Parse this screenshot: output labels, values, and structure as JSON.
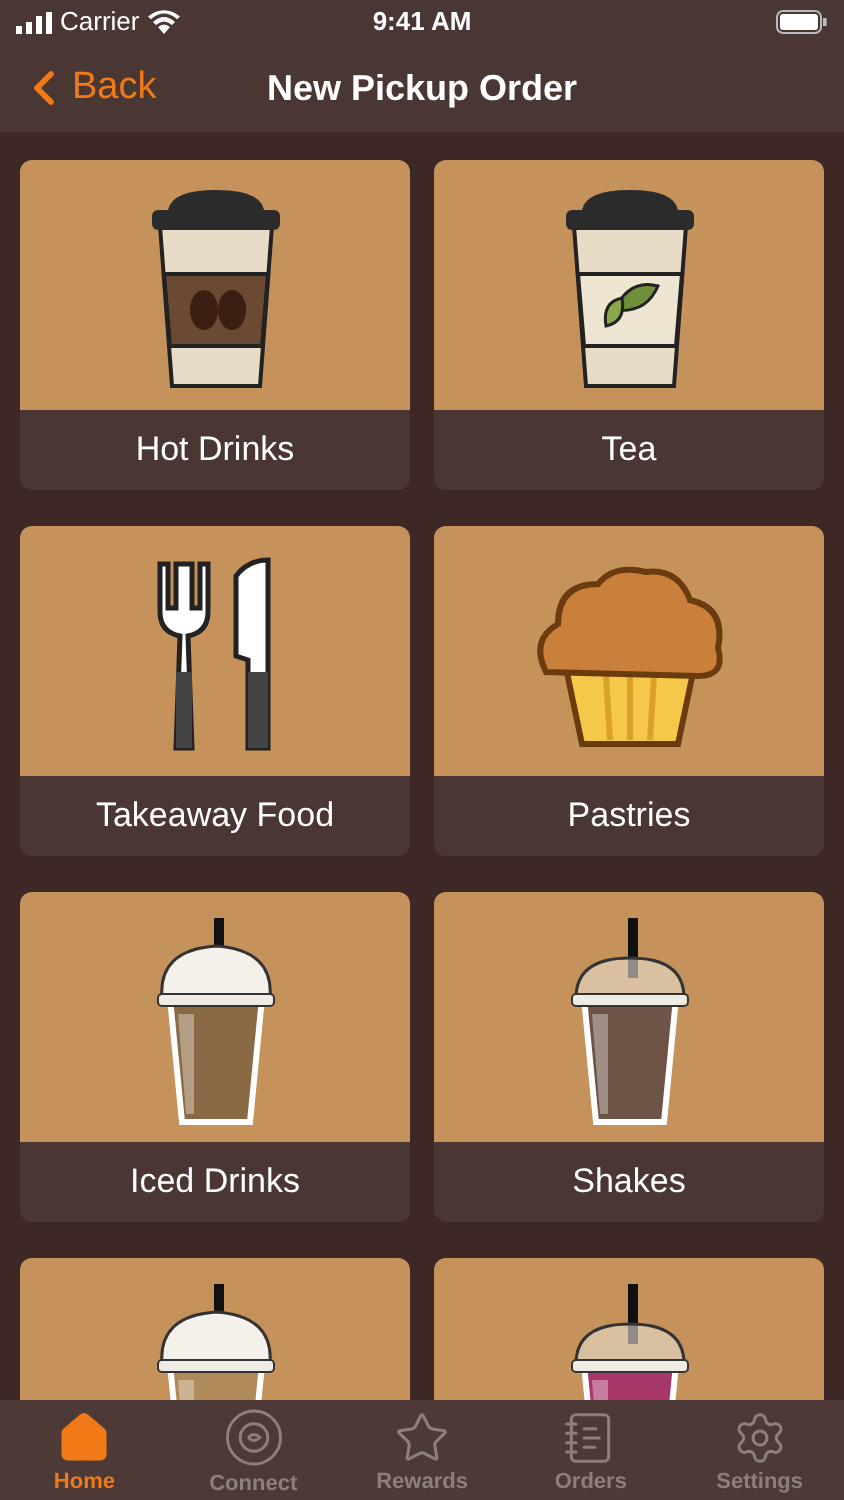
{
  "status_bar": {
    "carrier": "Carrier",
    "time": "9:41 AM"
  },
  "nav": {
    "back": "Back",
    "title": "New Pickup Order"
  },
  "tiles": [
    {
      "kind": "coffee-cup",
      "label": "Hot Drinks"
    },
    {
      "kind": "tea-cup",
      "label": "Tea"
    },
    {
      "kind": "cutlery",
      "label": "Takeaway Food"
    },
    {
      "kind": "muffin",
      "label": "Pastries"
    },
    {
      "kind": "iced-latte",
      "label": "Iced Drinks"
    },
    {
      "kind": "iced-shake",
      "label": "Shakes"
    },
    {
      "kind": "iced-cream"
    },
    {
      "kind": "smoothie"
    }
  ],
  "tab_bar": [
    {
      "kind": "home",
      "label": "Home",
      "selected": true
    },
    {
      "kind": "connect",
      "label": "Connect",
      "selected": false
    },
    {
      "kind": "rewards",
      "label": "Rewards",
      "selected": false
    },
    {
      "kind": "orders",
      "label": "Orders",
      "selected": false
    },
    {
      "kind": "settings",
      "label": "Settings",
      "selected": false
    }
  ]
}
